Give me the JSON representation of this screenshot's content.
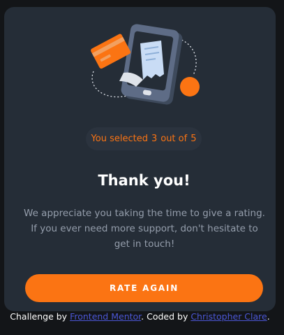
{
  "card": {
    "selected_prefix": "You selected",
    "selected_value": "3",
    "selected_middle": "out of",
    "selected_max": "5",
    "title": "Thank you!",
    "description": "We appreciate you taking the time to give a rating. If you ever need more support, don't hesitate to get in touch!",
    "button_label": "RATE AGAIN"
  },
  "footer": {
    "prefix": "Challenge by",
    "link1": "Frontend Mentor",
    "middle": ". Coded by",
    "link2": "Christopher Clare",
    "suffix": "."
  },
  "colors": {
    "background": "#131518",
    "card": "#252d37",
    "accent": "#fb7413",
    "text_muted": "#959eac",
    "link": "#4b57d6"
  },
  "icons": [
    "phone-receipt-illustration",
    "credit-card-icon",
    "orange-dot-icon"
  ]
}
